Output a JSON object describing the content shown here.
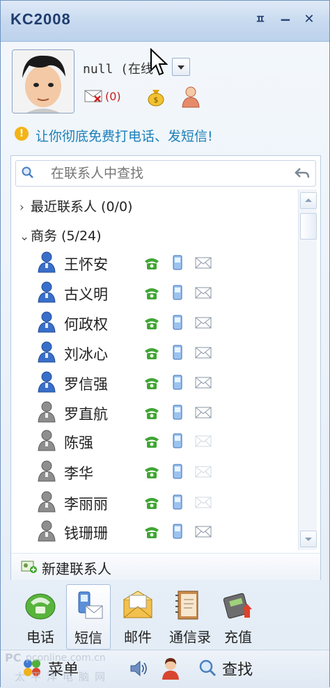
{
  "window": {
    "title": "KC2008",
    "pin_glyph": "ㅍ",
    "minimize_glyph": "−",
    "close_glyph": "✕"
  },
  "profile": {
    "username": "null (在线",
    "unread_mail": "(0)"
  },
  "promo": {
    "icon": "!",
    "text": "让你彻底免费打电话、发短信!"
  },
  "search": {
    "placeholder": "在联系人中查找"
  },
  "groups": [
    {
      "label": "最近联系人 (0/0)",
      "expanded": false
    },
    {
      "label": "商务 (5/24)",
      "expanded": true
    }
  ],
  "group_arrows": {
    "collapsed": "›",
    "expanded": "⌄"
  },
  "contacts": [
    {
      "name": "王怀安",
      "online": true,
      "sms": true
    },
    {
      "name": "古义明",
      "online": true,
      "sms": true
    },
    {
      "name": "何政权",
      "online": true,
      "sms": true
    },
    {
      "name": "刘冰心",
      "online": true,
      "sms": true
    },
    {
      "name": "罗信强",
      "online": true,
      "sms": true
    },
    {
      "name": "罗直航",
      "online": false,
      "sms": true
    },
    {
      "name": "陈强",
      "online": false,
      "sms": false
    },
    {
      "name": "李华",
      "online": false,
      "sms": false
    },
    {
      "name": "李丽丽",
      "online": false,
      "sms": false
    },
    {
      "name": "钱珊珊",
      "online": false,
      "sms": true
    }
  ],
  "new_contact": {
    "label": "新建联系人"
  },
  "toolbar": [
    {
      "label": "电话",
      "icon": "phone-icon",
      "selected": false
    },
    {
      "label": "短信",
      "icon": "sms-icon",
      "selected": true
    },
    {
      "label": "邮件",
      "icon": "mail-icon",
      "selected": false
    },
    {
      "label": "通信录",
      "icon": "address-book-icon",
      "selected": false
    },
    {
      "label": "充值",
      "icon": "recharge-icon",
      "selected": false
    }
  ],
  "bottombar": {
    "menu_label": "菜单",
    "find_label": "查找"
  },
  "watermark": {
    "logo": "PC",
    "domain": "pconline.com.cn",
    "cn": "太平洋电脑网"
  },
  "colors": {
    "accent": "#1a7fb8",
    "title": "#1f3c6d",
    "online": "#3a6fc9",
    "offline": "#8e8e8e",
    "phone": "#41a535"
  }
}
